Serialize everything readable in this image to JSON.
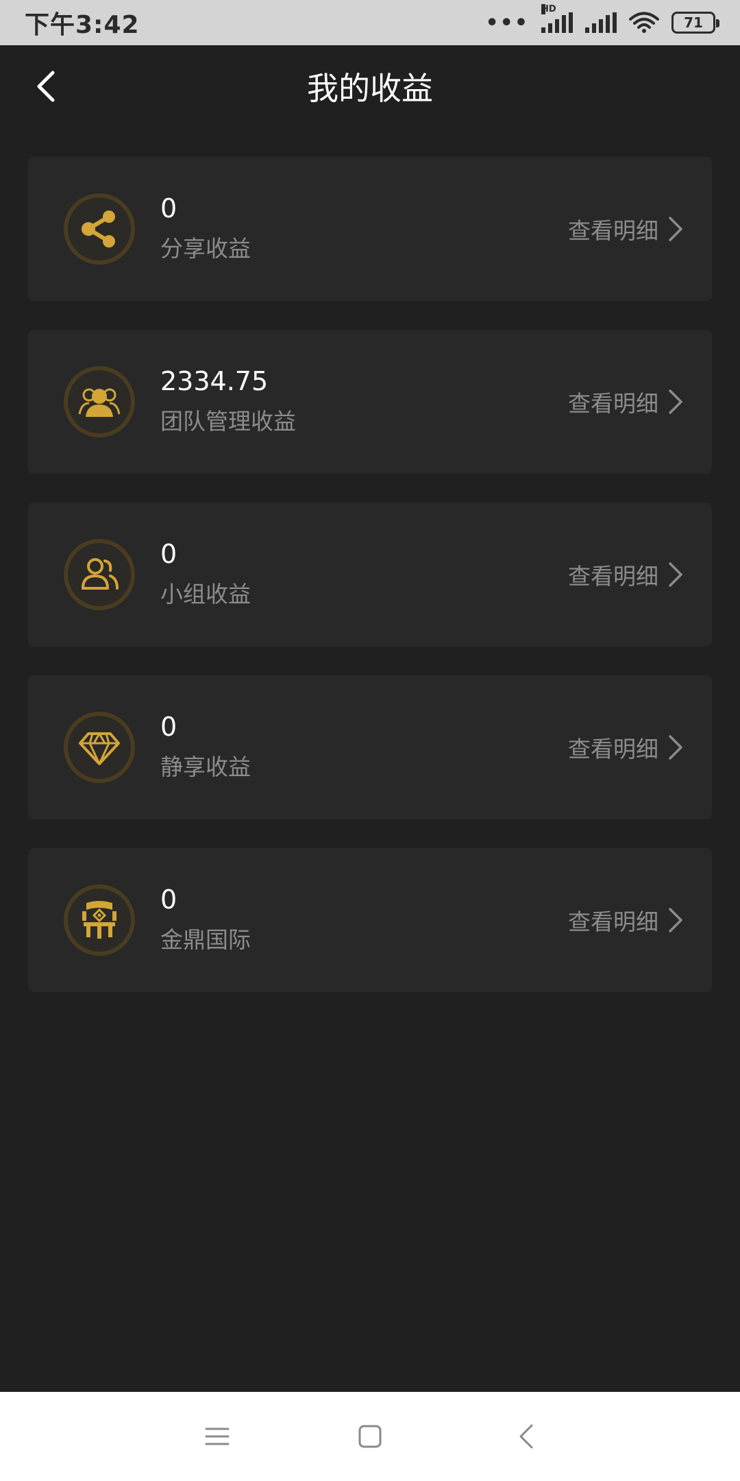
{
  "status_bar": {
    "time": "下午3:42",
    "dots": "•••",
    "hd": "HD",
    "battery": "71"
  },
  "header": {
    "title": "我的收益",
    "back_icon": "chevron-left-icon"
  },
  "cards": [
    {
      "value": "0",
      "label": "分享收益",
      "detail": "查看明细",
      "icon": "share-icon"
    },
    {
      "value": "2334.75",
      "label": "团队管理收益",
      "detail": "查看明细",
      "icon": "team-icon"
    },
    {
      "value": "0",
      "label": "小组收益",
      "detail": "查看明细",
      "icon": "group-icon"
    },
    {
      "value": "0",
      "label": "静享收益",
      "detail": "查看明细",
      "icon": "diamond-icon"
    },
    {
      "value": "0",
      "label": "金鼎国际",
      "detail": "查看明细",
      "icon": "jinding-logo-icon"
    }
  ],
  "colors": {
    "background": "#202020",
    "card": "#282828",
    "accent_gold": "#d4a537",
    "muted_text": "#8c8c8c"
  },
  "nav_bar": {
    "menu_icon": "menu-icon",
    "home_icon": "home-square-icon",
    "back_icon": "back-triangle-icon"
  }
}
